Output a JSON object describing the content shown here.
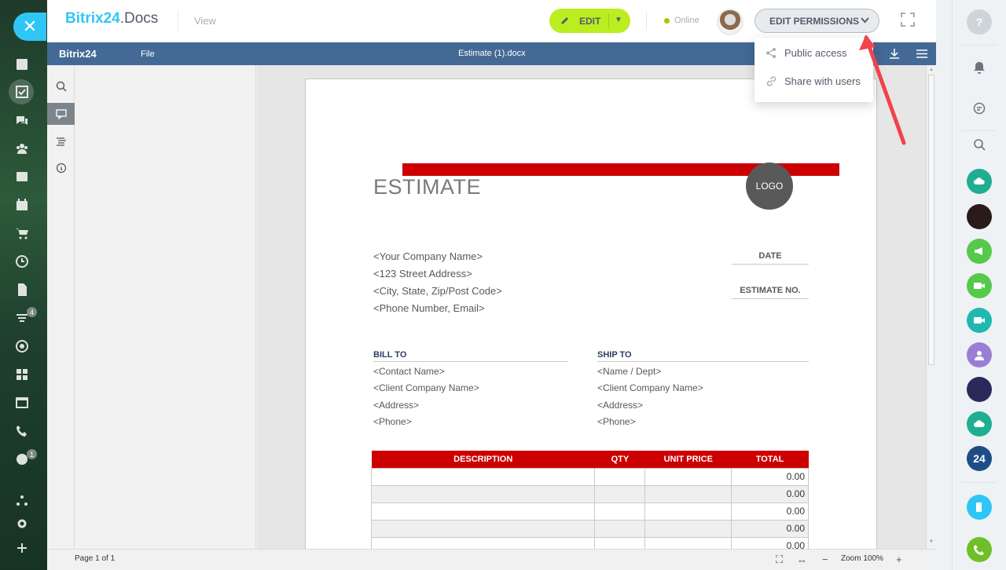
{
  "app": {
    "logo_main": "Bitrix24",
    "logo_suffix": ".Docs",
    "view_label": "View",
    "edit_label": "EDIT",
    "online_label": "Online",
    "permissions_label": "EDIT PERMISSIONS"
  },
  "permissions_menu": {
    "items": [
      {
        "label": "Public access",
        "icon": "share-nodes-icon"
      },
      {
        "label": "Share with users",
        "icon": "link-icon"
      }
    ]
  },
  "doc_toolbar": {
    "brand": "Bitrix24",
    "file_menu": "File",
    "doc_title": "Estimate (1).docx"
  },
  "document": {
    "heading": "ESTIMATE",
    "logo_text": "LOGO",
    "company_lines": [
      "<Your Company Name>",
      "<123 Street Address>",
      "<City, State, Zip/Post Code>",
      "<Phone Number, Email>"
    ],
    "date_label": "DATE",
    "estimate_no_label": "ESTIMATE NO.",
    "bill_to": {
      "heading": "BILL TO",
      "lines": [
        "<Contact Name>",
        "<Client Company Name>",
        "<Address>",
        "<Phone>"
      ]
    },
    "ship_to": {
      "heading": "SHIP TO",
      "lines": [
        "<Name / Dept>",
        "<Client Company Name>",
        "<Address>",
        "<Phone>"
      ]
    },
    "table": {
      "headers": [
        "DESCRIPTION",
        "QTY",
        "UNIT PRICE",
        "TOTAL"
      ],
      "totals": [
        "0.00",
        "0.00",
        "0.00",
        "0.00",
        "0.00"
      ]
    }
  },
  "status_bar": {
    "page_label": "Page 1 of 1",
    "zoom_label": "Zoom 100%"
  },
  "left_sidebar_badges": [
    "4",
    "1"
  ],
  "right_sidebar_badge": "24",
  "colors": {
    "accent_blue": "#2fc6f6",
    "edit_green": "#bbed21",
    "doc_bar": "#446995",
    "doc_red": "#cc0000",
    "annotation_arrow": "#f0444a"
  }
}
